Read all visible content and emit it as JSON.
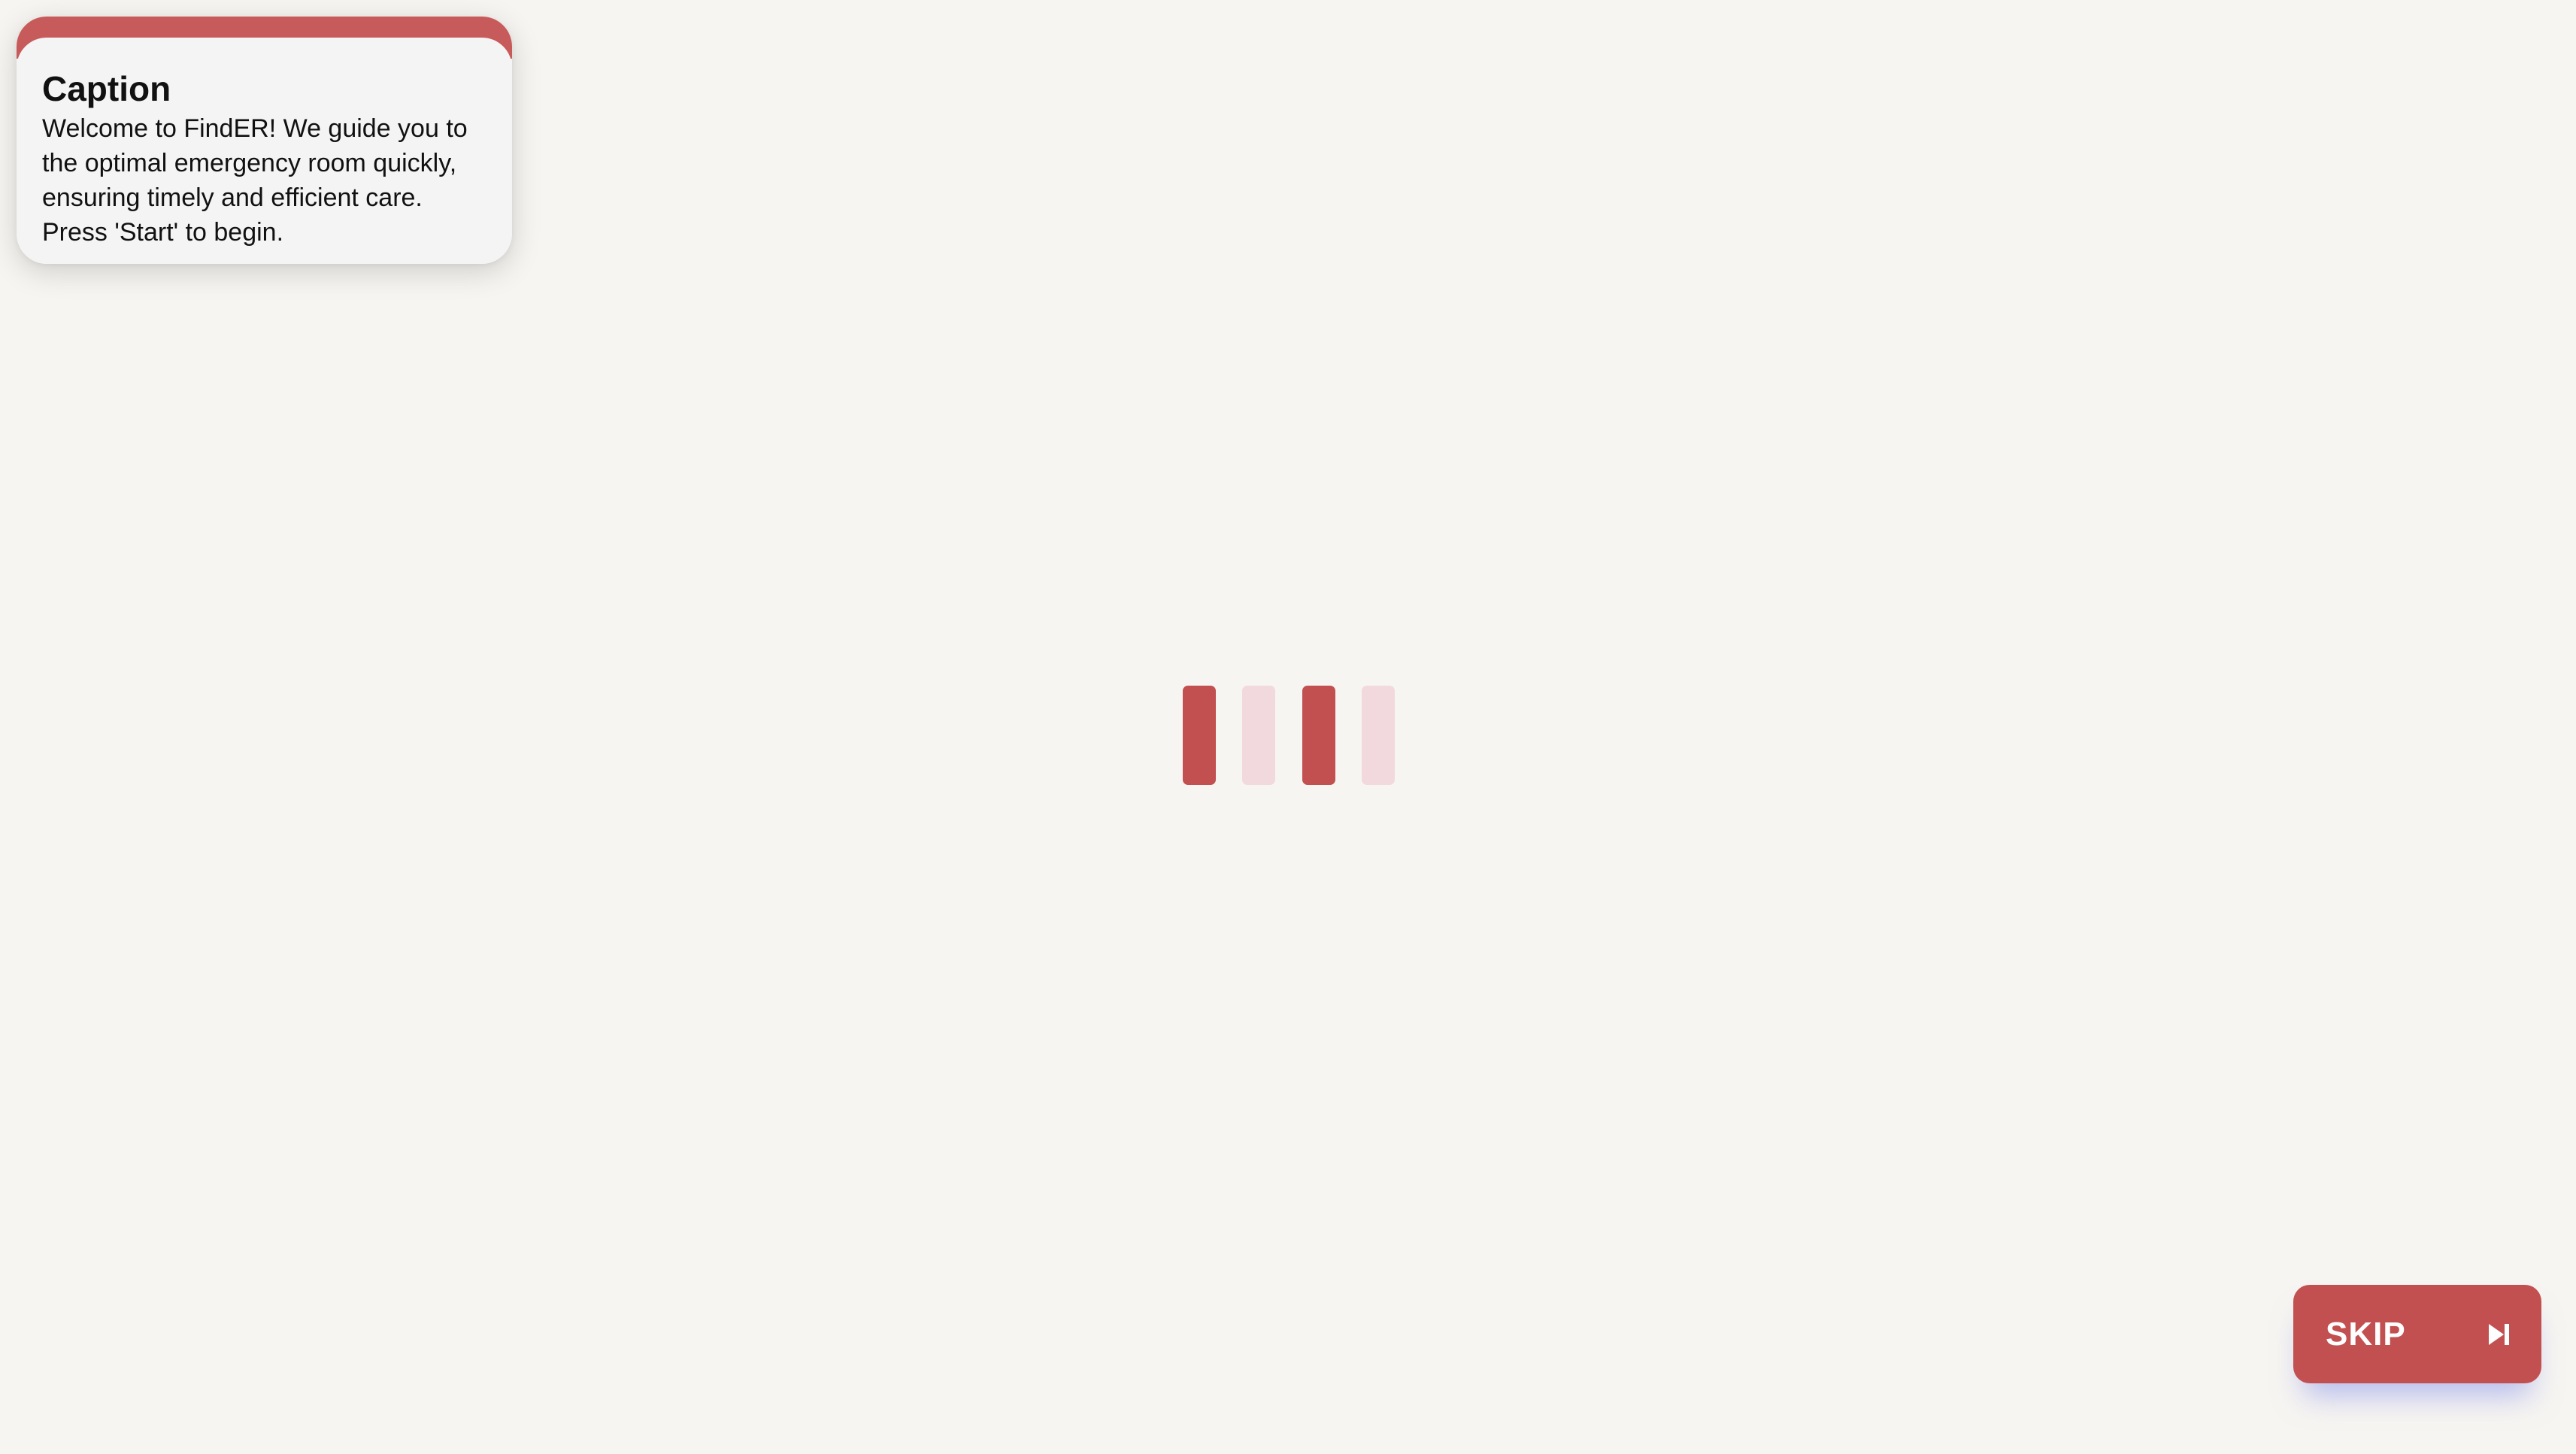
{
  "caption": {
    "title": "Caption",
    "text": "Welcome to FindER! We guide you to the optimal emergency room quickly, ensuring timely and efficient care. Press 'Start' to begin."
  },
  "loader": {
    "bars": [
      "on",
      "off",
      "on",
      "off"
    ]
  },
  "skip": {
    "label": "SKIP",
    "icon": "skip-next-icon"
  },
  "colors": {
    "accent": "#c25050",
    "accent_light": "#f1d9dd",
    "background": "#f7f5f1"
  }
}
